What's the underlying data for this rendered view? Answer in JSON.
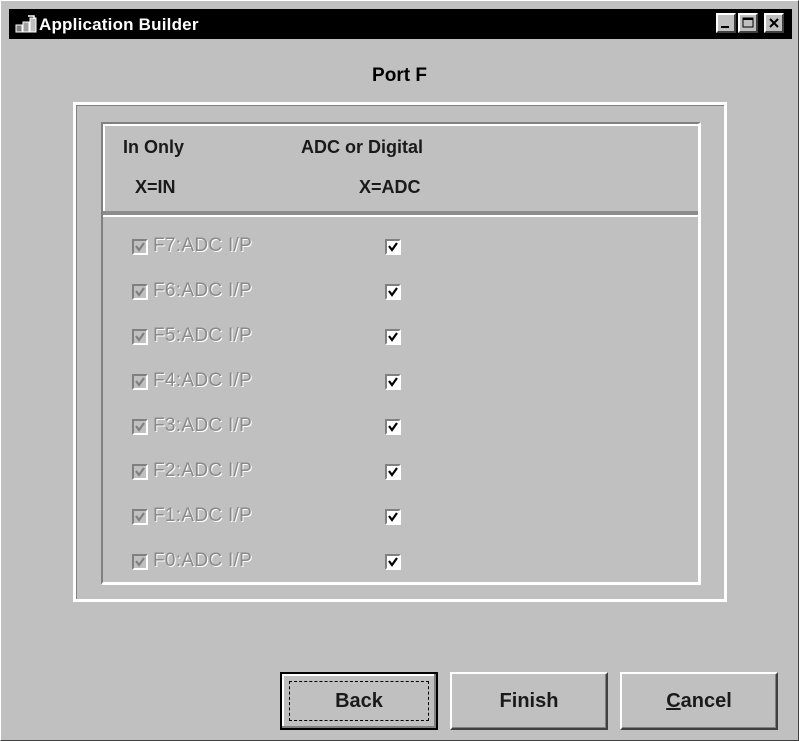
{
  "window": {
    "title": "Application Builder",
    "icon": "application-builder-icon",
    "controls": [
      "minimize-icon",
      "maximize-icon",
      "close-icon"
    ]
  },
  "page": {
    "title": "Port F"
  },
  "headers": {
    "col1_line1": "In Only",
    "col1_line2": "X=IN",
    "col2_line1": "ADC or Digital",
    "col2_line2": "X=ADC"
  },
  "rows": [
    {
      "label": "F7:ADC I/P",
      "in_only_checked": true,
      "in_only_enabled": false,
      "adc_checked": true
    },
    {
      "label": "F6:ADC I/P",
      "in_only_checked": true,
      "in_only_enabled": false,
      "adc_checked": true
    },
    {
      "label": "F5:ADC I/P",
      "in_only_checked": true,
      "in_only_enabled": false,
      "adc_checked": true
    },
    {
      "label": "F4:ADC I/P",
      "in_only_checked": true,
      "in_only_enabled": false,
      "adc_checked": true
    },
    {
      "label": "F3:ADC I/P",
      "in_only_checked": true,
      "in_only_enabled": false,
      "adc_checked": true
    },
    {
      "label": "F2:ADC I/P",
      "in_only_checked": true,
      "in_only_enabled": false,
      "adc_checked": true
    },
    {
      "label": "F1:ADC I/P",
      "in_only_checked": true,
      "in_only_enabled": false,
      "adc_checked": true
    },
    {
      "label": "F0:ADC I/P",
      "in_only_checked": true,
      "in_only_enabled": false,
      "adc_checked": true
    }
  ],
  "buttons": {
    "back": "Back",
    "finish": "Finish",
    "cancel_mnemonic": "C",
    "cancel_rest": "ancel"
  },
  "colors": {
    "titlebar": "#000000",
    "face": "#c0c0c0",
    "disabled_text": "#8a8a8a"
  }
}
